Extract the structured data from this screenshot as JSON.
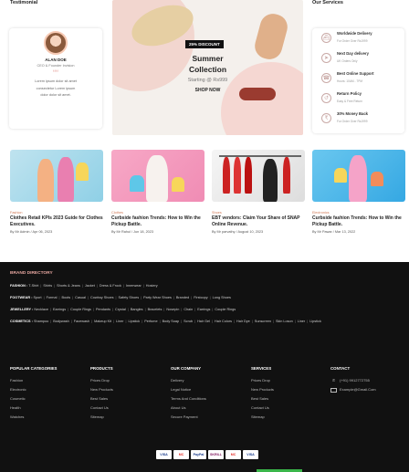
{
  "sections": {
    "testimonial": "Testimonial",
    "services": "Our Services"
  },
  "testimonial": {
    "name": "ALAN DOE",
    "role": "CEO & Founder Invision",
    "quote_mark": "““",
    "text": "Lorem ipsum dolor sit amet consectetur Lorem ipsum dolor dolor sit amet."
  },
  "hero": {
    "badge": "25% DISCOUNT",
    "title": "Summer Collection",
    "subtitle": "Starting @ Rs999",
    "cta": "SHOP NOW"
  },
  "services": [
    {
      "icon": "ship-icon",
      "glyph": "⛴",
      "title": "Worldwide Delivery",
      "sub": "For Order Over Rs1999"
    },
    {
      "icon": "rocket-icon",
      "glyph": "➤",
      "title": "Next Day delivery",
      "sub": "UK Orders Only"
    },
    {
      "icon": "phone-icon",
      "glyph": "☎",
      "title": "Best Online Support",
      "sub": "Hours: 10AM - 7PM"
    },
    {
      "icon": "return-icon",
      "glyph": "↺",
      "title": "Return Policy",
      "sub": "Easy & Free Return"
    },
    {
      "icon": "money-icon",
      "glyph": "₹",
      "title": "30% Money Back",
      "sub": "For Order Over Rs1999"
    }
  ],
  "posts": [
    {
      "category": "Fashion",
      "title": "Clothes Retail KPIs 2023 Guide for Clothes Executives.",
      "meta": "By Mr Admin / Apr 06, 2023"
    },
    {
      "category": "Clothes",
      "title": "Curbside fashion Trends: How to Win the Pickup Battle.",
      "meta": "By Mr Rahul / Jun 18, 2023"
    },
    {
      "category": "Shoes",
      "title": "EBT vendors: Claim Your Share of SNAP Online Revenue.",
      "meta": "By Mr parvathy / August 10, 2023"
    },
    {
      "category": "Electronics",
      "title": "Curbside fashion Trends: How to Win the Pickup Battle.",
      "meta": "By Mr Pawar / Mar 13, 2022"
    }
  ],
  "directory": {
    "title": "BRAND DIRECTORY",
    "rows": [
      {
        "label": "FASHION :",
        "items": [
          "T-Shirt",
          "Shirts",
          "Shorts & Jeans",
          "Jacket",
          "Dress & Frock",
          "Innerwear",
          "Hosiery"
        ]
      },
      {
        "label": "FOOTWEAR :",
        "items": [
          "Sport",
          "Formal",
          "Boots",
          "Casual",
          "Cowboy Shoes",
          "Safety Shoes",
          "Party Wear Shoes",
          "Branded",
          "Firstcopy",
          "Long Shoes"
        ]
      },
      {
        "label": "JEWELLERY :",
        "items": [
          "Necklace",
          "Earrings",
          "Couple Rings",
          "Pendants",
          "Crystal",
          "Bangles",
          "Bracelets",
          "Nosepin",
          "Chain",
          "Earrings",
          "Couple Rings"
        ]
      },
      {
        "label": "COSMETICS :",
        "items": [
          "Shampoo",
          "Bodywash",
          "Facewash",
          "Makeup Kit",
          "Liner",
          "Lipstick",
          "Perfume",
          "Body Soap",
          "Scrub",
          "Hair Gel",
          "Hair Colors",
          "Hair Dye",
          "Sunscreen",
          "Skin Loson",
          "Liner",
          "Lipstick"
        ]
      }
    ]
  },
  "footer": {
    "categories": {
      "title": "POPULAR CATEGORIES",
      "links": [
        "Fashion",
        "Electronic",
        "Cosmetic",
        "Health",
        "Watches"
      ]
    },
    "products": {
      "title": "PRODUCTS",
      "links": [
        "Prices Drop",
        "New Products",
        "Best Sales",
        "Contact Us",
        "Sitemap"
      ]
    },
    "company": {
      "title": "OUR COMPANY",
      "links": [
        "Delivery",
        "Legal Notice",
        "Terms And Conditions",
        "About Us",
        "Secure Payment"
      ]
    },
    "services": {
      "title": "SERVICES",
      "links": [
        "Prices Drop",
        "New Products",
        "Best Sales",
        "Contact Us",
        "Sitemap"
      ]
    },
    "contact": {
      "title": "CONTACT",
      "phone": "(+91) 9912772755",
      "email": "Example@Gmail.Com"
    },
    "payments": [
      "VISA",
      "MC",
      "PayPal",
      "SKRILL",
      "MC",
      "VISA"
    ]
  },
  "colors": {
    "accent": "#e8a7a0",
    "footer_bg": "#111111",
    "category": "#d27a57",
    "bar": "#3ab54a"
  }
}
